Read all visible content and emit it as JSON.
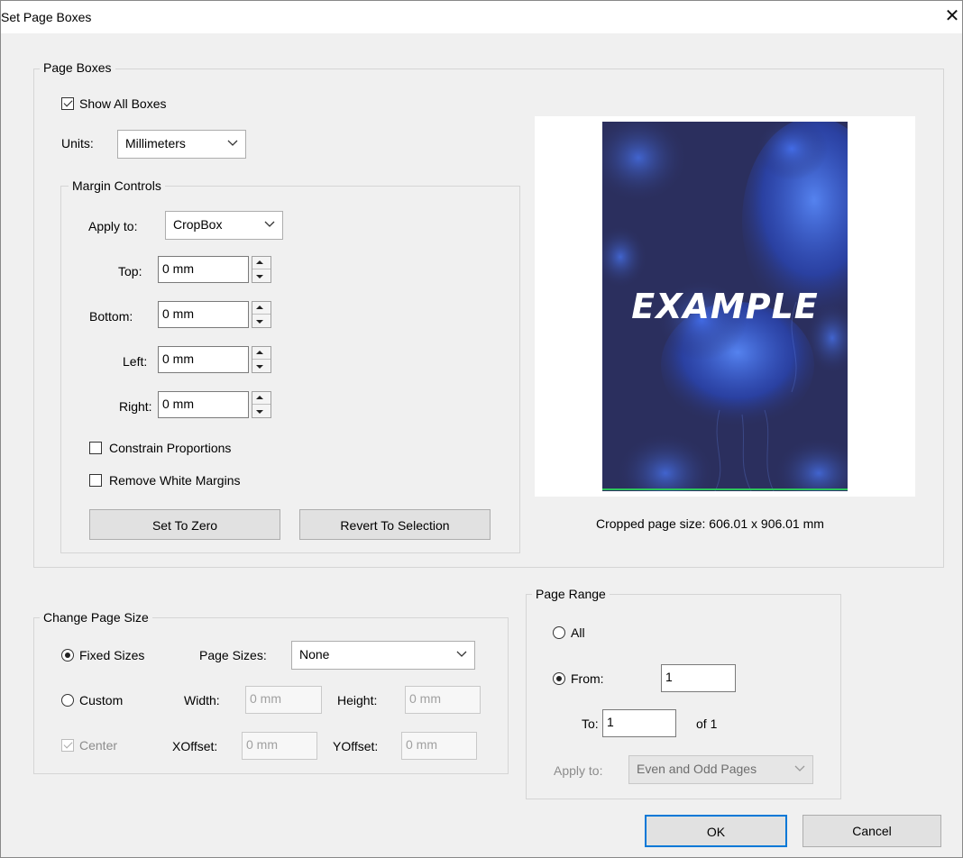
{
  "window": {
    "title": "Set Page Boxes",
    "close_glyph": "✕"
  },
  "page_boxes": {
    "legend": "Page Boxes",
    "show_all_boxes": {
      "label": "Show All Boxes",
      "checked": true
    },
    "units": {
      "label": "Units:",
      "value": "Millimeters"
    },
    "margin_controls": {
      "legend": "Margin Controls",
      "apply_to": {
        "label": "Apply to:",
        "value": "CropBox"
      },
      "top": {
        "label": "Top:",
        "value": "0 mm"
      },
      "bottom": {
        "label": "Bottom:",
        "value": "0 mm"
      },
      "left": {
        "label": "Left:",
        "value": "0 mm"
      },
      "right": {
        "label": "Right:",
        "value": "0 mm"
      },
      "constrain": {
        "label": "Constrain Proportions",
        "checked": false
      },
      "remove_white": {
        "label": "Remove White Margins",
        "checked": false
      },
      "set_zero_label": "Set To Zero",
      "revert_label": "Revert To Selection"
    },
    "preview": {
      "page_text": "EXAMPLE",
      "caption": "Cropped page size: 606.01 x 906.01 mm",
      "page_color": "#2b2f5e"
    }
  },
  "change_page_size": {
    "legend": "Change Page Size",
    "fixed_sizes": {
      "label": "Fixed Sizes",
      "selected": true
    },
    "page_sizes": {
      "label": "Page Sizes:",
      "value": "None"
    },
    "custom": {
      "label": "Custom",
      "selected": false
    },
    "width": {
      "label": "Width:",
      "value": "0 mm"
    },
    "height": {
      "label": "Height:",
      "value": "0 mm"
    },
    "center": {
      "label": "Center",
      "checked": true
    },
    "xoffset": {
      "label": "XOffset:",
      "value": "0 mm"
    },
    "yoffset": {
      "label": "YOffset:",
      "value": "0 mm"
    }
  },
  "page_range": {
    "legend": "Page Range",
    "all": {
      "label": "All",
      "selected": false
    },
    "from": {
      "label": "From:",
      "value": "1",
      "selected": true
    },
    "to": {
      "label": "To:",
      "value": "1",
      "of_label": "of 1"
    },
    "apply_to": {
      "label": "Apply to:",
      "value": "Even and Odd Pages"
    }
  },
  "footer": {
    "ok_label": "OK",
    "cancel_label": "Cancel"
  },
  "colors": {
    "accent": "#0078d7",
    "dialog_bg": "#f0f0f0"
  }
}
